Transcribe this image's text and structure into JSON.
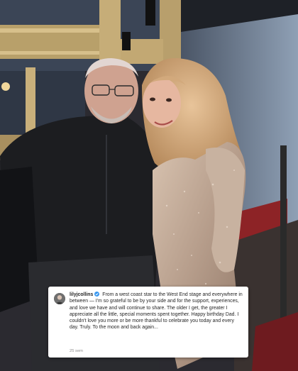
{
  "caption": {
    "username": "lilyjcollins",
    "verified": true,
    "text": "From a west coast star to the West End stage and everywhere in between — I'm so grateful to be by your side and for the support, experiences, and love we have and will continue to share. The older I get, the greater I appreciate all the little, special moments spent together. Happy birthday Dad. I couldn't love you more or be more thankful to celebrate you today and every day. Truly. To the moon and back again...",
    "timestamp": "25 sem"
  },
  "colors": {
    "verified_badge": "#3897f0",
    "card_background": "#ffffff",
    "timestamp": "#8e8e8e"
  },
  "icons": {
    "avatar": "profile-avatar",
    "verified": "verified-badge-icon"
  }
}
